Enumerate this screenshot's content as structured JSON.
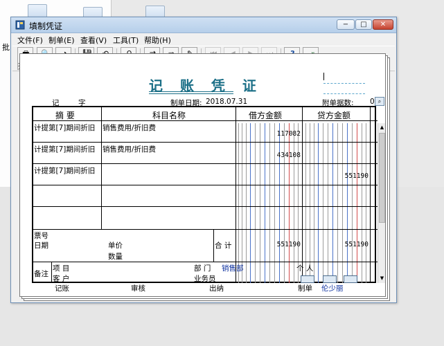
{
  "background": {
    "left_label": "批"
  },
  "window": {
    "title": "填制凭证",
    "controls": {
      "minimize_glyph": "−",
      "maximize_glyph": "□",
      "close_glyph": "✕"
    }
  },
  "menu": [
    {
      "label": "文件(F)"
    },
    {
      "label": "制单(E)"
    },
    {
      "label": "查看(V)"
    },
    {
      "label": "工具(T)"
    },
    {
      "label": "帮助(H)"
    }
  ],
  "toolbar": [
    {
      "label": "打印",
      "icon": "printer-icon",
      "glyph": "🖶",
      "enabled": true
    },
    {
      "label": "预览",
      "icon": "preview-icon",
      "glyph": "🔍",
      "enabled": true
    },
    {
      "label": "输出",
      "icon": "export-icon",
      "glyph": "➜",
      "enabled": true
    },
    {
      "label": "保存",
      "icon": "save-icon",
      "glyph": "💾",
      "enabled": true
    },
    {
      "label": "放弃",
      "icon": "undo-icon",
      "glyph": "↶",
      "enabled": true
    },
    {
      "label": "查询",
      "icon": "binoculars-icon",
      "glyph": "⚲",
      "enabled": true
    },
    {
      "label": "插分",
      "icon": "insert-row-icon",
      "glyph": "⇉",
      "enabled": true
    },
    {
      "label": "删分",
      "icon": "delete-row-icon",
      "glyph": "⇛",
      "enabled": true
    },
    {
      "label": "流量",
      "icon": "cashflow-icon",
      "glyph": "✎",
      "enabled": true
    },
    {
      "label": "首张",
      "icon": "first-record-icon",
      "glyph": "⏮",
      "enabled": false
    },
    {
      "label": "上张",
      "icon": "previous-record-icon",
      "glyph": "◀",
      "enabled": false
    },
    {
      "label": "下张",
      "icon": "next-record-icon",
      "glyph": "▶",
      "enabled": false
    },
    {
      "label": "末张",
      "icon": "last-record-icon",
      "glyph": "⏭",
      "enabled": false
    },
    {
      "label": "帮助",
      "icon": "help-icon",
      "glyph": "?",
      "enabled": true
    },
    {
      "label": "退出",
      "icon": "exit-icon",
      "glyph": "⇥",
      "enabled": true
    }
  ],
  "voucher": {
    "title": "记 账 凭 证",
    "word_label": "记",
    "word_suffix": "字",
    "date_label": "制单日期:",
    "date_value": "2018.07.31",
    "attach_label": "附单据数:",
    "attach_value": "0",
    "columns": {
      "summary": "摘 要",
      "account": "科目名称",
      "debit": "借方金额",
      "credit": "贷方金额"
    },
    "rows": [
      {
        "summary": "计提第[7]期间折旧",
        "account": "销售费用/折旧费",
        "debit": "117082",
        "credit": ""
      },
      {
        "summary": "计提第[7]期间折旧",
        "account": "销售费用/折旧费",
        "debit": "434108",
        "credit": ""
      },
      {
        "summary": "计提第[7]期间折旧",
        "account": "",
        "debit": "",
        "credit": "551190"
      },
      {
        "summary": "",
        "account": "",
        "debit": "",
        "credit": ""
      },
      {
        "summary": "",
        "account": "",
        "debit": "",
        "credit": ""
      }
    ],
    "total": {
      "ticket_label": "票号",
      "date_label": "日期",
      "unit_price_label": "单价",
      "quantity_label": "数量",
      "label": "合 计",
      "debit": "551190",
      "credit": "551190"
    },
    "remarks": {
      "label": "备注",
      "project_label": "项  目",
      "customer_label": "客  户",
      "department_label": "部  门",
      "department_value": "销售部",
      "person_label": "个  人",
      "salesman_label": "业务员"
    },
    "footer": {
      "bookkeeper_label": "记账",
      "reviewer_label": "审核",
      "cashier_label": "出纳",
      "maker_label": "制单",
      "maker_value": "伦少丽"
    }
  },
  "colors": {
    "title_teal": "#1b6f87",
    "link_blue": "#0a2e9e",
    "red_rule": "#d34a4a",
    "blue_rule": "#4a72c8"
  }
}
